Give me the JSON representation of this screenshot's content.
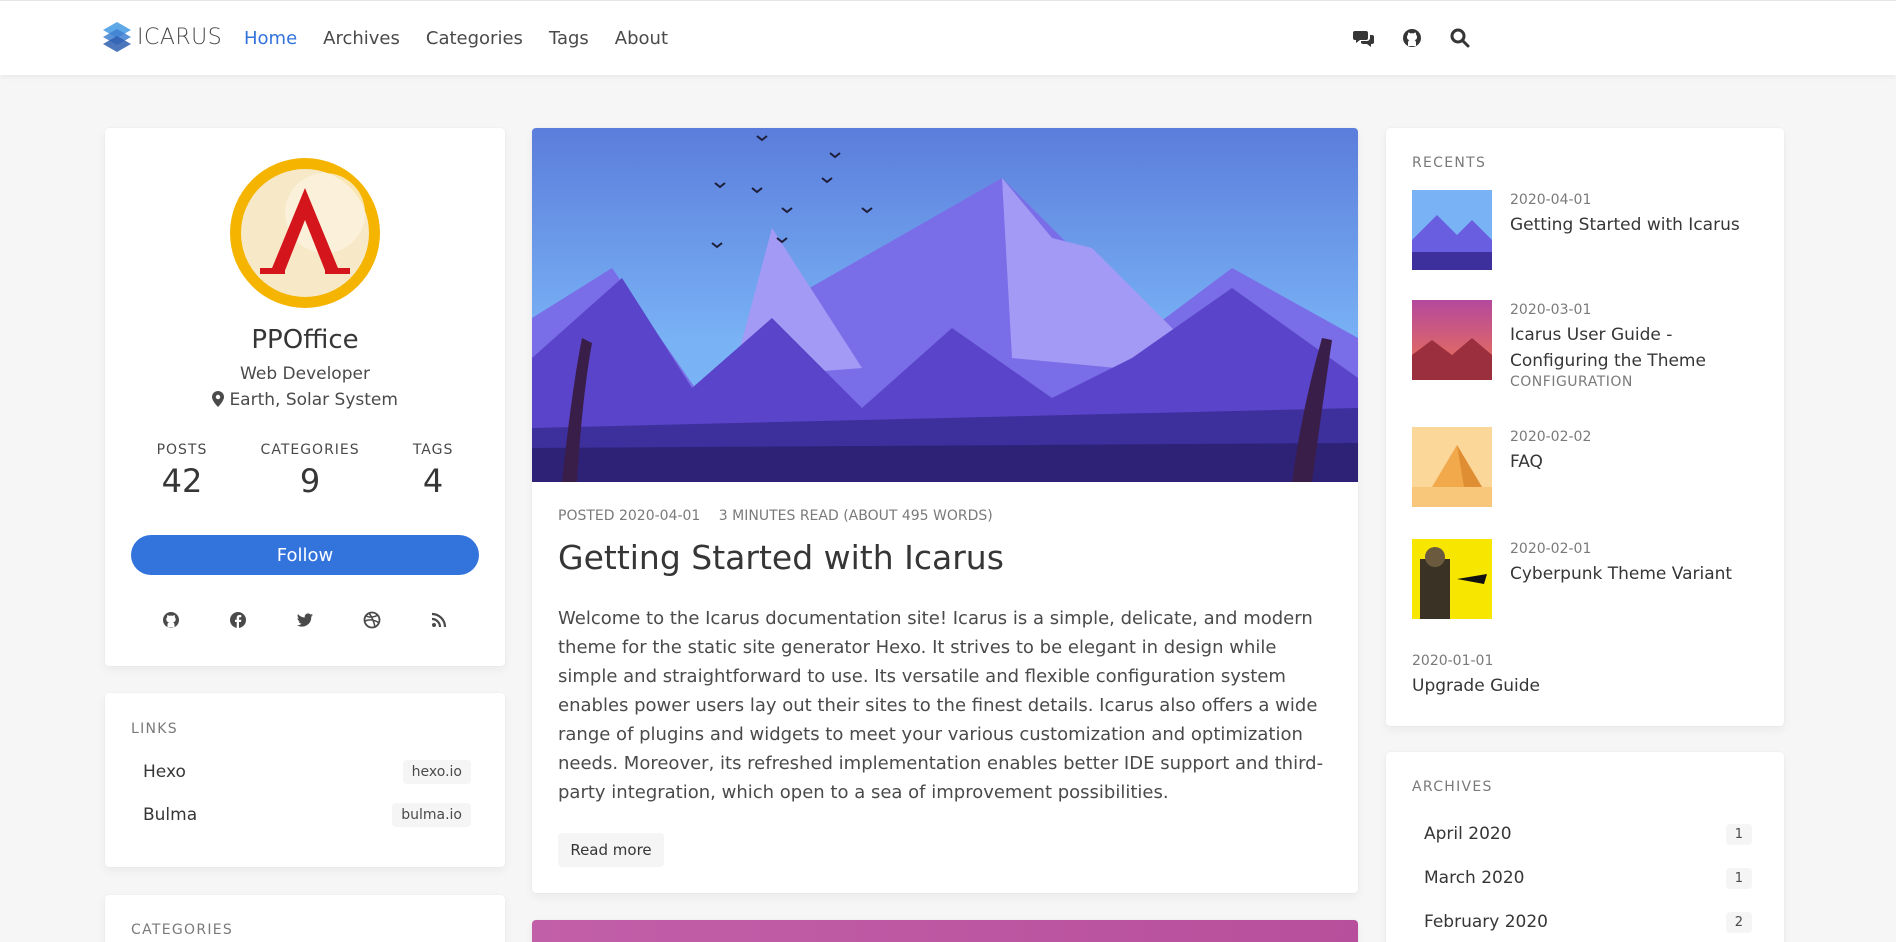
{
  "nav": {
    "logo_text": "ICARUS",
    "links": [
      "Home",
      "Archives",
      "Categories",
      "Tags",
      "About"
    ],
    "active_link": "Home"
  },
  "profile": {
    "name": "PPOffice",
    "role": "Web Developer",
    "location": "Earth, Solar System",
    "stats": [
      {
        "label": "POSTS",
        "value": "42"
      },
      {
        "label": "CATEGORIES",
        "value": "9"
      },
      {
        "label": "TAGS",
        "value": "4"
      }
    ],
    "follow_label": "Follow",
    "socials": [
      "github-icon",
      "facebook-icon",
      "twitter-icon",
      "dribbble-icon",
      "rss-icon"
    ]
  },
  "links": {
    "title": "LINKS",
    "items": [
      {
        "name": "Hexo",
        "url": "hexo.io"
      },
      {
        "name": "Bulma",
        "url": "bulma.io"
      }
    ]
  },
  "categories": {
    "title": "CATEGORIES"
  },
  "post": {
    "posted": "POSTED 2020-04-01",
    "read_time": "3 MINUTES READ (ABOUT 495 WORDS)",
    "title": "Getting Started with Icarus",
    "excerpt": "Welcome to the Icarus documentation site! Icarus is a simple, delicate, and modern theme for the static site generator Hexo. It strives to be elegant in design while simple and straightforward to use. Its versatile and flexible configuration system enables power users lay out their sites to the finest details. Icarus also offers a wide range of plugins and widgets to meet your various customization and optimization needs. Moreover, its refreshed implementation enables better IDE support and third-party integration, which open to a sea of improvement possibilities.",
    "read_more": "Read more"
  },
  "recents": {
    "title": "RECENTS",
    "items": [
      {
        "date": "2020-04-01",
        "title": "Getting Started with Icarus",
        "category": ""
      },
      {
        "date": "2020-03-01",
        "title": "Icarus User Guide - Configuring the Theme",
        "category": "CONFIGURATION"
      },
      {
        "date": "2020-02-02",
        "title": "FAQ",
        "category": ""
      },
      {
        "date": "2020-02-01",
        "title": "Cyberpunk Theme Variant",
        "category": ""
      },
      {
        "date": "2020-01-01",
        "title": "Upgrade Guide",
        "category": ""
      }
    ]
  },
  "archives": {
    "title": "ARCHIVES",
    "items": [
      {
        "month": "April 2020",
        "count": "1"
      },
      {
        "month": "March 2020",
        "count": "1"
      },
      {
        "month": "February 2020",
        "count": "2"
      }
    ]
  },
  "colors": {
    "accent": "#3273dc",
    "background": "#f6f6f6",
    "card": "#ffffff"
  }
}
